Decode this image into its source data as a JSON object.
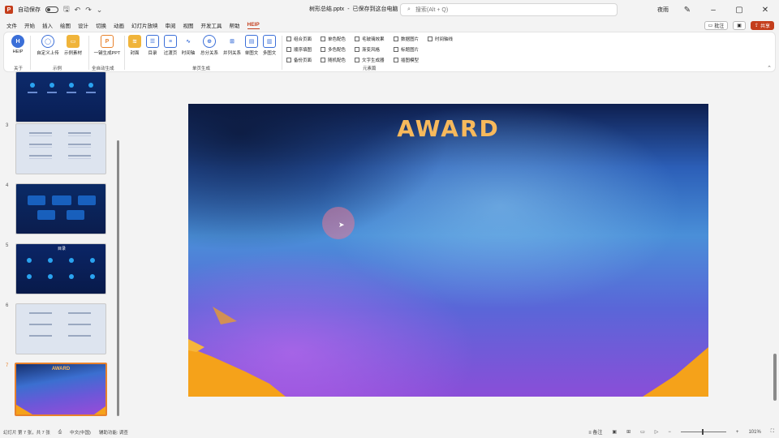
{
  "titlebar": {
    "autosave_label": "自动保存",
    "file_name": "树形总结.pptx",
    "save_status": "已保存到这台电脑",
    "search_placeholder": "搜索(Alt + Q)",
    "user": "夜雨"
  },
  "menu": {
    "items": [
      "文件",
      "开始",
      "插入",
      "绘图",
      "设计",
      "切换",
      "动画",
      "幻灯片放映",
      "审阅",
      "视图",
      "开发工具",
      "帮助",
      "HEIP"
    ],
    "active": "HEIP",
    "comments_label": "批注",
    "share_label": "共享"
  },
  "ribbon": {
    "groups": [
      {
        "label": "关于",
        "buttons": [
          "HEIP"
        ]
      },
      {
        "label": "示例",
        "buttons": [
          "自定义上传",
          "示例素材"
        ]
      },
      {
        "label": "全自动生成",
        "buttons": [
          "一键生成PPT"
        ]
      },
      {
        "label": "单页生成",
        "buttons": [
          "封面",
          "目录",
          "过渡页",
          "时间轴",
          "总分关系",
          "并列关系",
          "单图文",
          "多图文"
        ]
      },
      {
        "label": "元素篇",
        "checks": [
          [
            "组合页面",
            "单色配色",
            "毛玻璃效果",
            "数据图片",
            "时间轴线"
          ],
          [
            "顺序填图",
            "多色配色",
            "渐变风格",
            "标题图片"
          ],
          [
            "备份页面",
            "随机配色",
            "文字生成器",
            "插图模型"
          ]
        ]
      }
    ]
  },
  "slides": [
    {
      "number": "",
      "theme": "dark-blue-circles"
    },
    {
      "number": "3",
      "theme": "light-list"
    },
    {
      "number": "4",
      "theme": "dark-blue-boxes"
    },
    {
      "number": "5",
      "theme": "dark-blue-grid",
      "title": "目录"
    },
    {
      "number": "6",
      "theme": "light-list"
    },
    {
      "number": "7",
      "theme": "award",
      "title": "AWARD",
      "selected": true
    }
  ],
  "current_slide": {
    "title": "AWARD"
  },
  "status": {
    "slide_info": "幻灯片 第 7 张，共 7 张",
    "language": "中文(中国)",
    "accessibility": "辅助功能: 调查",
    "notes_label": "备注",
    "zoom": "101%"
  },
  "colors": {
    "accent": "#c43e1c",
    "award_title": "#f7b95c",
    "selection": "#e8822c"
  }
}
